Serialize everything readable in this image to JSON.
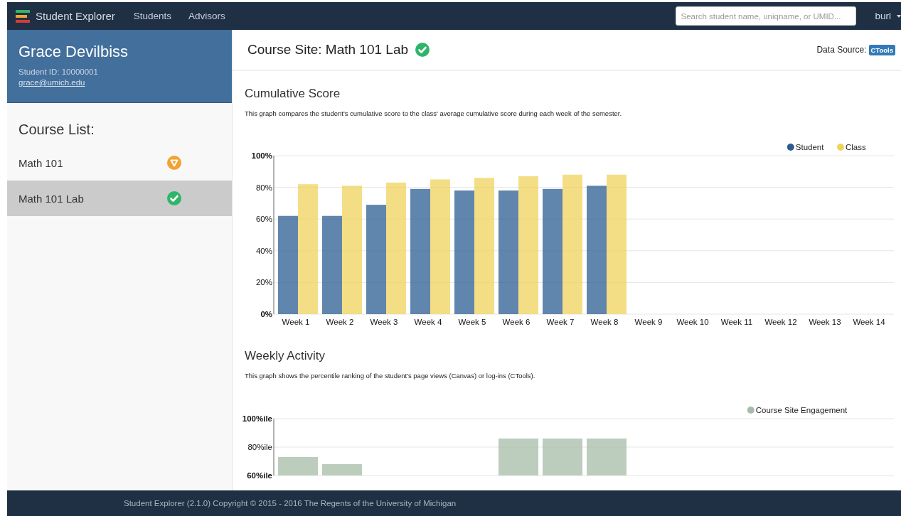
{
  "navbar": {
    "brand": "Student Explorer",
    "links": [
      {
        "label": "Students"
      },
      {
        "label": "Advisors"
      }
    ],
    "search": {
      "placeholder": "Search student name, uniqname, or UMID..."
    },
    "user": "burl"
  },
  "student": {
    "name": "Grace Devilbiss",
    "student_id": "Student ID: 10000001",
    "email": "grace@umich.edu"
  },
  "course_list": {
    "title": "Course List:",
    "items": [
      {
        "name": "Math 101",
        "kind": "warning",
        "selected": false
      },
      {
        "name": "Math 101 Lab",
        "kind": "ok",
        "selected": true
      }
    ]
  },
  "course_site": {
    "title": "Course Site: Math 101 Lab",
    "status_icon": {
      "kind": "ok"
    },
    "data_source_label": "Data Source:",
    "data_source": "CTools"
  },
  "sections": [
    {
      "title": "Cumulative Score",
      "description": "This graph compares the student's cumulative score to the class' average cumulative score during each week of the semester.",
      "chart_data": {
        "type": "bar",
        "categories": [
          "Week 1",
          "Week 2",
          "Week 3",
          "Week 4",
          "Week 5",
          "Week 6",
          "Week 7",
          "Week 8",
          "Week 9",
          "Week 10",
          "Week 11",
          "Week 12",
          "Week 13",
          "Week 14"
        ],
        "series": [
          {
            "name": "Student",
            "color": "#2c5d92",
            "values": [
              62,
              62,
              69,
              79,
              78,
              78,
              79,
              81,
              null,
              null,
              null,
              null,
              null,
              null
            ]
          },
          {
            "name": "Class",
            "color": "#f0d35c",
            "values": [
              82,
              81,
              83,
              85,
              86,
              87,
              88,
              88,
              null,
              null,
              null,
              null,
              null,
              null
            ]
          }
        ],
        "grid": true,
        "legend": "top-right",
        "ylim": [
          0,
          100
        ],
        "yticks": [
          {
            "value": 0,
            "label": "0%"
          },
          {
            "value": 20,
            "label": "20%"
          },
          {
            "value": 40,
            "label": "40%"
          },
          {
            "value": 60,
            "label": "60%"
          },
          {
            "value": 80,
            "label": "80%"
          },
          {
            "value": 100,
            "label": "100%"
          }
        ]
      }
    },
    {
      "title": "Weekly Activity",
      "description": "This graph shows the percentile ranking of the student's page views (Canvas) or log-ins (CTools).",
      "chart_data": {
        "type": "bar",
        "series": [
          {
            "name": "Course Site Engagement",
            "color": "#a6bca8",
            "values": [
              73,
              68,
              null,
              null,
              null,
              86,
              86,
              86,
              null,
              null,
              null,
              null,
              null,
              null
            ]
          }
        ],
        "grid": true,
        "legend": "top-right",
        "ylim": [
          60,
          100
        ],
        "yticks": [
          {
            "value": 60,
            "label": "60%ile"
          },
          {
            "value": 80,
            "label": "80%ile"
          },
          {
            "value": 100,
            "label": "100%ile"
          }
        ]
      }
    }
  ],
  "footer": "Student Explorer (2.1.0) Copyright © 2015 - 2016 The Regents of the University of Michigan"
}
